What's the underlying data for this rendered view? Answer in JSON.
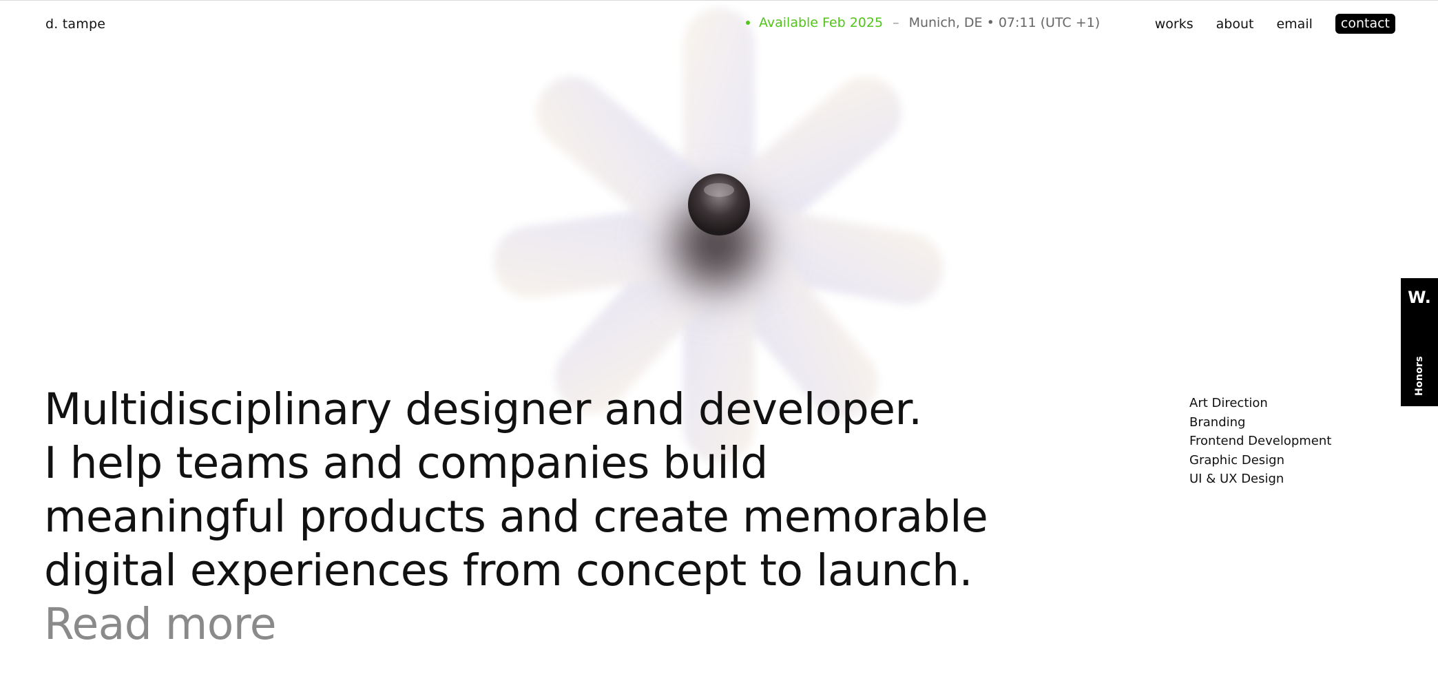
{
  "header": {
    "logo": "d. tampe",
    "status": {
      "available": "Available Feb 2025",
      "separator": "–",
      "location_time": "Munich, DE • 07:11 (UTC +1)",
      "accent_color": "#52c41a"
    },
    "nav": [
      {
        "label": "works"
      },
      {
        "label": "about"
      },
      {
        "label": "email"
      },
      {
        "label": "contact"
      }
    ]
  },
  "hero": {
    "lines": [
      "Multidisciplinary designer and developer.",
      "I help teams and companies build",
      "meaningful products and create memorable",
      "digital experiences from concept to launch."
    ],
    "read_more": "Read more"
  },
  "services": [
    "Art Direction",
    "Branding",
    "Frontend Development",
    "Graphic Design",
    "UI & UX Design"
  ],
  "honors_badge": {
    "mark": "W.",
    "label": "Honors"
  },
  "art": {
    "icon": "flower-3d-art"
  }
}
